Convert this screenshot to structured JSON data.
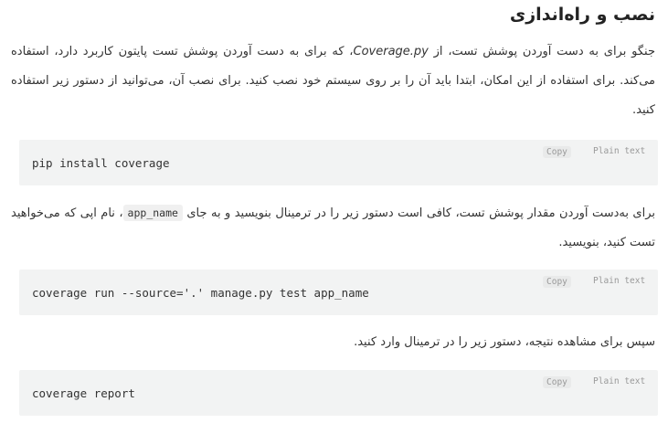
{
  "heading": "نصب و راه‌اندازی",
  "intro": {
    "part1": "جنگو برای به دست آوردن پوشش تست، از ",
    "coverage_py": "Coverage.py",
    "part2": "، که برای به دست آوردن پوشش تست پایتون کاربرد دارد، استفاده می‌کند. برای استفاده از این امکان، ابتدا باید آن را بر روی سیستم خود نصب کنید. برای نصب آن، می‌توانید از دستور زیر استفاده کنید."
  },
  "code_block_1": {
    "copy_label": "Copy",
    "language": "Plain text",
    "code": "pip install coverage"
  },
  "run_paragraph": {
    "part1": "برای به‌دست آوردن مقدار پوشش تست، کافی است دستور زیر را در ترمینال بنویسید و به جای ",
    "inline_code": "app_name",
    "part2": "، نام اپی که می‌خواهید تست کنید، بنویسید."
  },
  "code_block_2": {
    "copy_label": "Copy",
    "language": "Plain text",
    "code": "coverage run --source='.' manage.py test app_name"
  },
  "report_paragraph": "سپس برای مشاهده نتیجه، دستور زیر را در ترمینال وارد کنید.",
  "code_block_3": {
    "copy_label": "Copy",
    "language": "Plain text",
    "code": "coverage report"
  }
}
